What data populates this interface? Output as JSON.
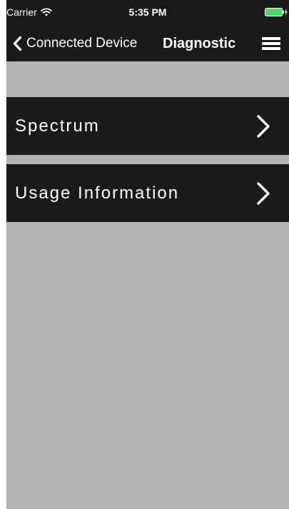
{
  "status_bar": {
    "carrier": "Carrier",
    "time": "5:35 PM",
    "wifi_icon": "wifi-icon",
    "battery_icon": "battery-charging-icon",
    "battery_color": "#4cd964"
  },
  "nav": {
    "back_icon": "chevron-left-icon",
    "back_label": "Connected Device",
    "title": "Diagnostic",
    "menu_icon": "hamburger-menu-icon"
  },
  "menu": {
    "items": [
      {
        "label": "Spectrum",
        "icon": "chevron-right-icon"
      },
      {
        "label": "Usage Information",
        "icon": "chevron-right-icon"
      }
    ]
  },
  "colors": {
    "bar_background": "#1a1a1a",
    "content_background": "#b3b3b3",
    "text": "#ffffff"
  }
}
